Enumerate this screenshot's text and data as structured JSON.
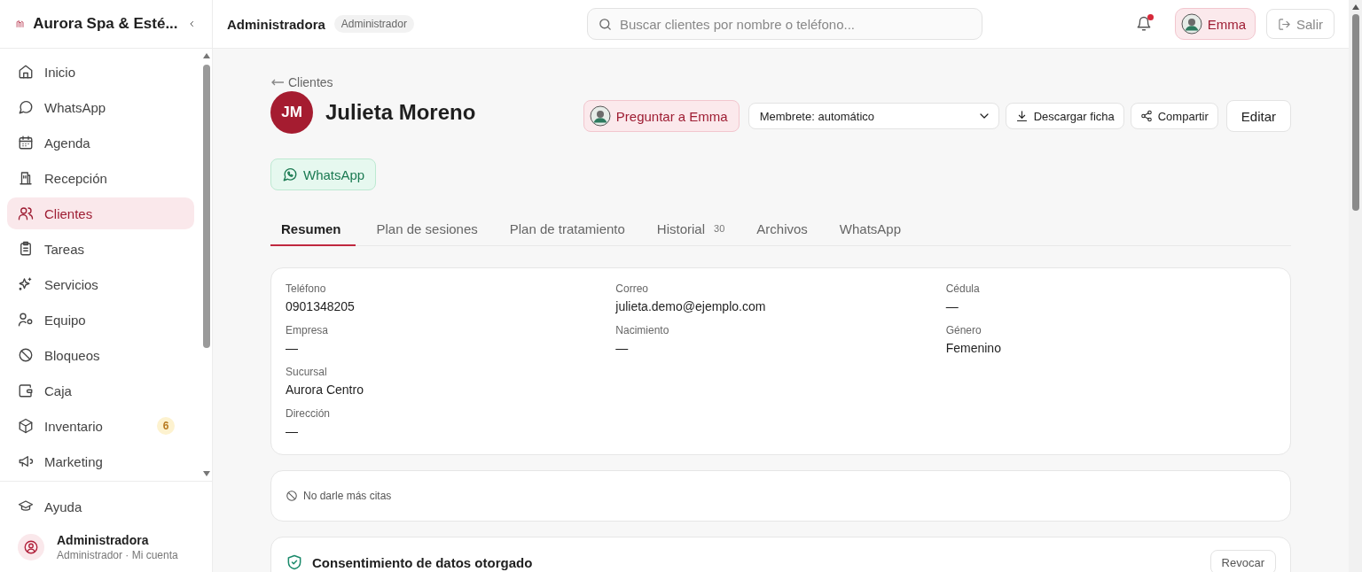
{
  "sidebar": {
    "brand": "Aurora Spa & Esté...",
    "items": [
      {
        "label": "Inicio",
        "selected": false
      },
      {
        "label": "WhatsApp",
        "selected": false
      },
      {
        "label": "Agenda",
        "selected": false
      },
      {
        "label": "Recepción",
        "selected": false
      },
      {
        "label": "Clientes",
        "selected": true
      },
      {
        "label": "Tareas",
        "selected": false
      },
      {
        "label": "Servicios",
        "selected": false
      },
      {
        "label": "Equipo",
        "selected": false
      },
      {
        "label": "Bloqueos",
        "selected": false
      },
      {
        "label": "Caja",
        "selected": false
      },
      {
        "label": "Inventario",
        "selected": false,
        "badge": "6"
      },
      {
        "label": "Marketing",
        "selected": false
      }
    ],
    "help": "Ayuda",
    "account": {
      "name": "Administradora",
      "subtitle": "Administrador · Mi cuenta"
    }
  },
  "topbar": {
    "user": "Administradora",
    "role": "Administrador",
    "search": {
      "placeholder": "Buscar clientes por nombre o teléfono..."
    },
    "notifications_unread": true,
    "assistant": "Emma",
    "logout": "Salir"
  },
  "client": {
    "back": "Clientes",
    "initials": "JM",
    "name": "Julieta Moreno",
    "ask": "Preguntar a Emma",
    "letterhead": "Membrete: automático",
    "download": "Descargar ficha",
    "share": "Compartir",
    "edit": "Editar",
    "whatsapp": "WhatsApp",
    "tabs": [
      {
        "label": "Resumen",
        "selected": true
      },
      {
        "label": "Plan de sesiones",
        "selected": false
      },
      {
        "label": "Plan de tratamiento",
        "selected": false
      },
      {
        "label": "Historial",
        "count": "30",
        "selected": false
      },
      {
        "label": "Archivos",
        "selected": false
      },
      {
        "label": "WhatsApp",
        "selected": false
      }
    ],
    "fields": [
      [
        {
          "label": "Teléfono",
          "value": "0901348205"
        },
        {
          "label": "Correo",
          "value": "julieta.demo@ejemplo.com"
        },
        {
          "label": "Cédula",
          "value": "—"
        }
      ],
      [
        {
          "label": "Empresa",
          "value": "—"
        },
        {
          "label": "Nacimiento",
          "value": "—"
        },
        {
          "label": "Género",
          "value": "Femenino"
        }
      ],
      [
        {
          "label": "Sucursal",
          "value": "Aurora Centro"
        }
      ],
      [
        {
          "label": "Dirección",
          "value": "—"
        }
      ]
    ],
    "note": "No darle más citas",
    "consent": {
      "title": "Consentimiento de datos otorgado",
      "action": "Revocar"
    }
  }
}
